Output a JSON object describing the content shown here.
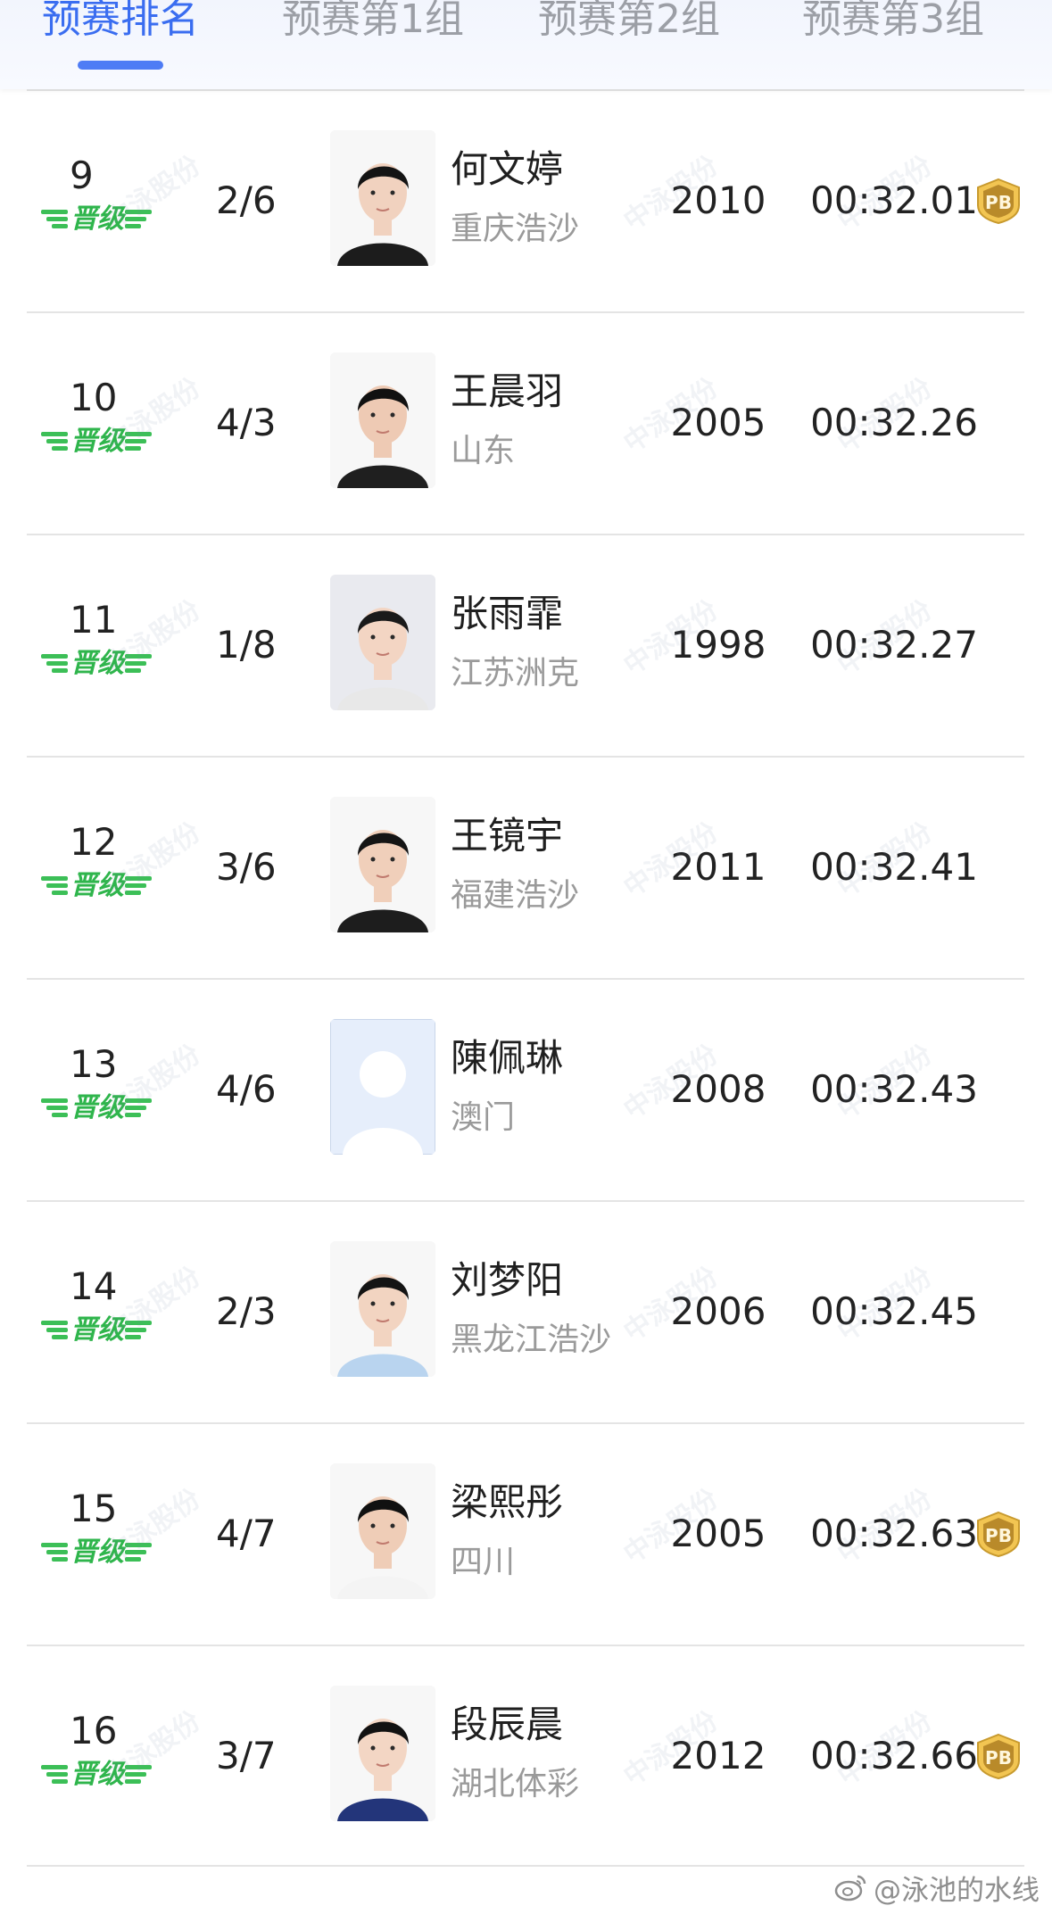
{
  "tabs": [
    {
      "label": "预赛排名",
      "active": true
    },
    {
      "label": "预赛第1组",
      "active": false
    },
    {
      "label": "预赛第2组",
      "active": false
    },
    {
      "label": "预赛第3组",
      "active": false
    }
  ],
  "colors": {
    "accent": "#3a6df0",
    "advance_green": "#2fb54c",
    "pb_gold": "#e3b448"
  },
  "advance_badge": "晋级",
  "watermark": "中泳股份",
  "rows": [
    {
      "rank": "9",
      "heat_lane": "2/6",
      "name": "何文婷",
      "team": "重庆浩沙",
      "year": "2010",
      "time": "00:32.01",
      "pb": "PB",
      "photo_icon": "athlete-photo"
    },
    {
      "rank": "10",
      "heat_lane": "4/3",
      "name": "王晨羽",
      "team": "山东",
      "year": "2005",
      "time": "00:32.26",
      "pb": null,
      "photo_icon": "athlete-photo"
    },
    {
      "rank": "11",
      "heat_lane": "1/8",
      "name": "张雨霏",
      "team": "江苏洲克",
      "year": "1998",
      "time": "00:32.27",
      "pb": null,
      "photo_icon": "athlete-photo"
    },
    {
      "rank": "12",
      "heat_lane": "3/6",
      "name": "王镜宇",
      "team": "福建浩沙",
      "year": "2011",
      "time": "00:32.41",
      "pb": null,
      "photo_icon": "athlete-photo"
    },
    {
      "rank": "13",
      "heat_lane": "4/6",
      "name": "陳佩琳",
      "team": "澳门",
      "year": "2008",
      "time": "00:32.43",
      "pb": null,
      "photo_icon": "placeholder-avatar"
    },
    {
      "rank": "14",
      "heat_lane": "2/3",
      "name": "刘梦阳",
      "team": "黑龙江浩沙",
      "year": "2006",
      "time": "00:32.45",
      "pb": null,
      "photo_icon": "athlete-photo"
    },
    {
      "rank": "15",
      "heat_lane": "4/7",
      "name": "梁熙彤",
      "team": "四川",
      "year": "2005",
      "time": "00:32.63",
      "pb": "PB",
      "photo_icon": "athlete-photo"
    },
    {
      "rank": "16",
      "heat_lane": "3/7",
      "name": "段辰晨",
      "team": "湖北体彩",
      "year": "2012",
      "time": "00:32.66",
      "pb": "PB",
      "photo_icon": "athlete-photo"
    }
  ],
  "footer": {
    "weibo_handle": "@泳池的水线",
    "icon": "weibo-icon"
  }
}
